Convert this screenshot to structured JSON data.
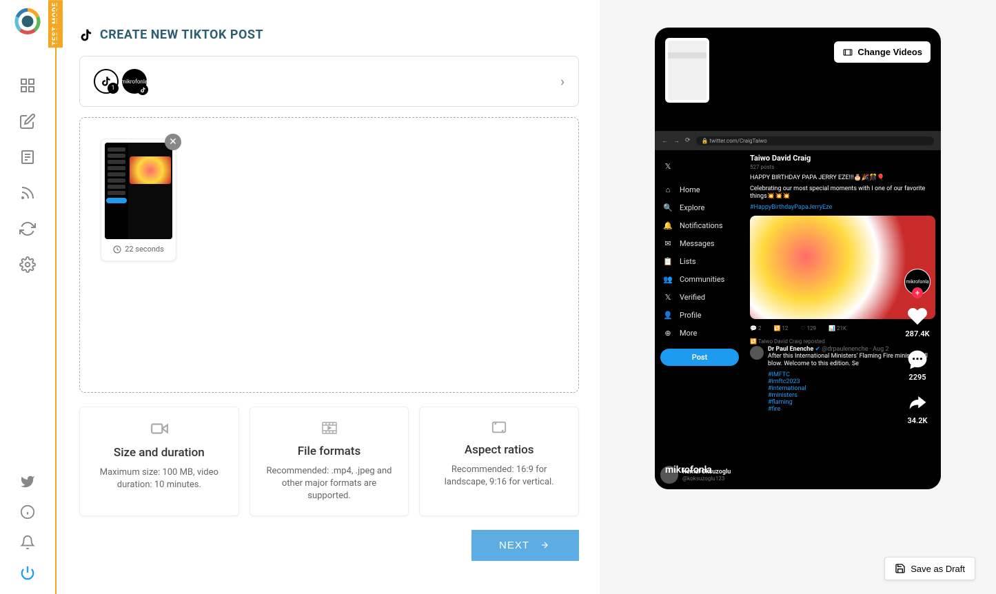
{
  "test_mode_label": "TEST MODE",
  "page_title": "CREATE NEW TIKTOK POST",
  "account_bar": {
    "count_badge": "1"
  },
  "video_thumb": {
    "duration": "22 seconds"
  },
  "info_cards": [
    {
      "title": "Size and duration",
      "desc": "Maximum size: 100 MB, video duration: 10 minutes."
    },
    {
      "title": "File formats",
      "desc": "Recommended: .mp4, .jpeg and other major formats are supported."
    },
    {
      "title": "Aspect ratios",
      "desc": "Recommended: 16:9 for landscape, 9:16 for vertical."
    }
  ],
  "next_button": "NEXT",
  "change_videos_button": "Change Videos",
  "save_draft_button": "Save as Draft",
  "twitter_nav": [
    "Home",
    "Explore",
    "Notifications",
    "Messages",
    "Lists",
    "Communities",
    "Verified",
    "Profile",
    "More"
  ],
  "twitter_post_btn": "Post",
  "feed": {
    "profile_name": "Taiwo David Craig",
    "profile_posts": "527 posts",
    "line1": "HAPPY BIRTHDAY PAPA JERRY EZE!!!🎂🎉🎊🎈",
    "line2": "Celebrating our most special moments with I one of our favorite things💥💥💥",
    "hashtag1": "#HappyBirthdayPapaJerryEze",
    "reply": "2",
    "retweet": "12",
    "like": "129",
    "views": "21K",
    "reposted": "Taiwo David Craig reposted",
    "user2_name": "Dr Paul Enenche",
    "user2_handle": "@drpaulenenche · Aug 2",
    "user2_text": "After this International Ministers' Flaming Fire ministry will blow. Welcome to this edition. Se",
    "tags": [
      "#IMFTC",
      "#imftc2023",
      "#international",
      "#ministers",
      "#flaming",
      "#fire"
    ],
    "bottom_user": "Kemal Oksuzoglu",
    "bottom_handle": "@koksuzoglu123",
    "browser_url": "twitter.com/CraigTaiwo"
  },
  "tiktok": {
    "likes": "287.4K",
    "comments": "2295",
    "shares": "34.2K",
    "username": "mikrofonla"
  }
}
